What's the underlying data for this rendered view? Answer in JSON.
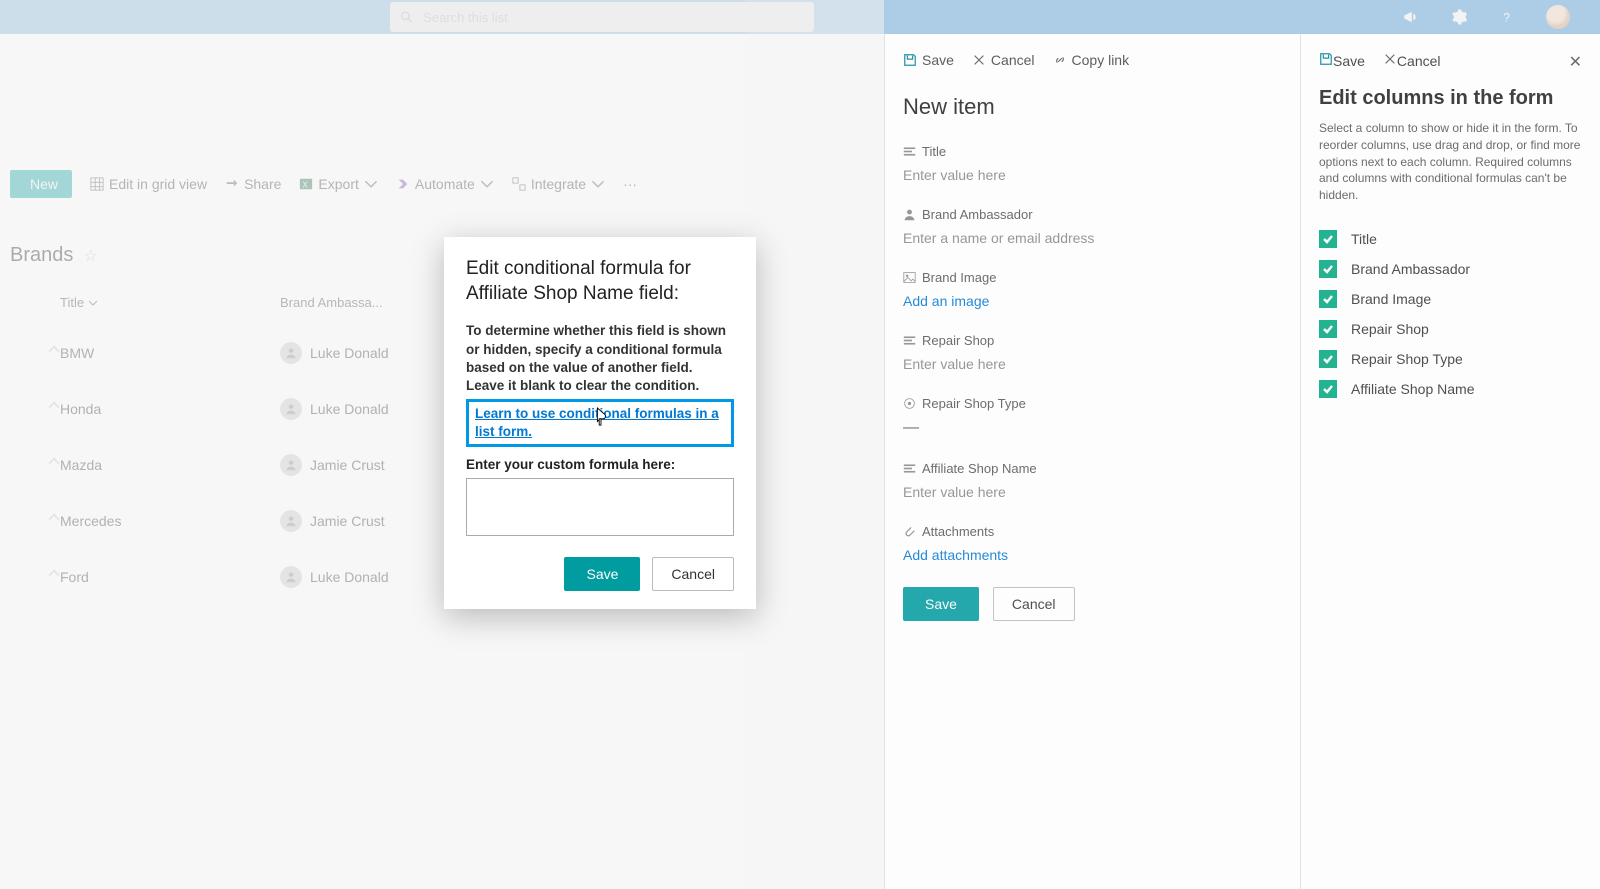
{
  "topbar": {
    "search_placeholder": "Search this list"
  },
  "commandbar": {
    "new": "New",
    "grid": "Edit in grid view",
    "share": "Share",
    "export": "Export",
    "automate": "Automate",
    "integrate": "Integrate"
  },
  "list": {
    "title": "Brands",
    "columns": {
      "title": "Title",
      "brand": "Brand Ambassa..."
    },
    "rows": [
      {
        "title": "BMW",
        "brand": "Luke Donald"
      },
      {
        "title": "Honda",
        "brand": "Luke Donald"
      },
      {
        "title": "Mazda",
        "brand": "Jamie Crust"
      },
      {
        "title": "Mercedes",
        "brand": "Jamie Crust"
      },
      {
        "title": "Ford",
        "brand": "Luke Donald"
      }
    ]
  },
  "newitem": {
    "bar": {
      "save": "Save",
      "cancel": "Cancel",
      "copy": "Copy link"
    },
    "title": "New item",
    "fields": {
      "title": {
        "label": "Title",
        "placeholder": "Enter value here"
      },
      "brand_ambassador": {
        "label": "Brand Ambassador",
        "placeholder": "Enter a name or email address"
      },
      "brand_image": {
        "label": "Brand Image",
        "link": "Add an image"
      },
      "repair_shop": {
        "label": "Repair Shop",
        "placeholder": "Enter value here"
      },
      "repair_shop_type": {
        "label": "Repair Shop Type",
        "value": "—"
      },
      "affiliate_shop_name": {
        "label": "Affiliate Shop Name",
        "placeholder": "Enter value here"
      },
      "attachments": {
        "label": "Attachments",
        "link": "Add attachments"
      }
    },
    "actions": {
      "save": "Save",
      "cancel": "Cancel"
    }
  },
  "editcols": {
    "bar": {
      "save": "Save",
      "cancel": "Cancel"
    },
    "title": "Edit columns in the form",
    "desc": "Select a column to show or hide it in the form. To reorder columns, use drag and drop, or find more options next to each column. Required columns and columns with conditional formulas can't be hidden.",
    "items": [
      "Title",
      "Brand Ambassador",
      "Brand Image",
      "Repair Shop",
      "Repair Shop Type",
      "Affiliate Shop Name"
    ]
  },
  "modal": {
    "title": "Edit conditional formula for Affiliate Shop Name field:",
    "desc": "To determine whether this field is shown or hidden, specify a conditional formula based on the value of another field. Leave it blank to clear the condition.",
    "link": "Learn to use conditional formulas in a list form.",
    "label": "Enter your custom formula here:",
    "actions": {
      "save": "Save",
      "cancel": "Cancel"
    }
  }
}
